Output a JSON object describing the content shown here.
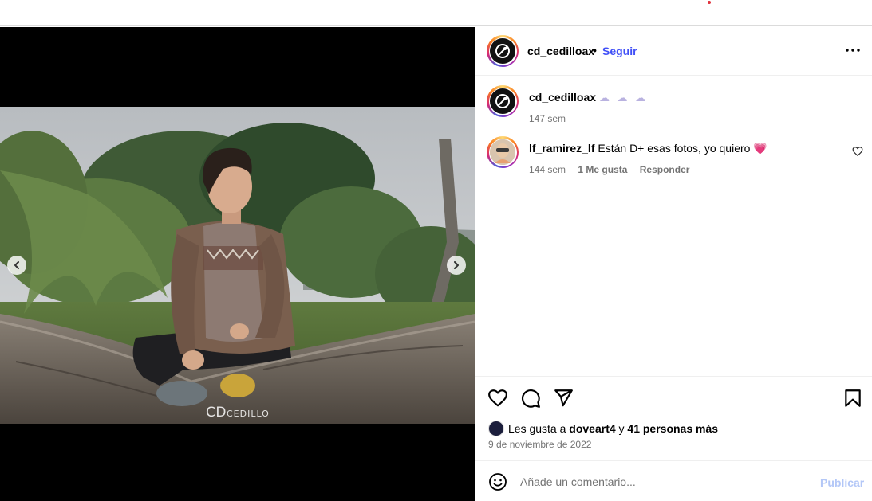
{
  "post": {
    "author": "cd_cedilloax",
    "follow_label": "Seguir",
    "separator": "•",
    "caption_emoji": "☁︎ ☁︎ ☁︎",
    "caption_age": "147 sem",
    "watermark_main": "CD",
    "watermark_sub": "CEDILLO"
  },
  "comments": [
    {
      "username": "lf_ramirez_lf",
      "text": "Están D+ esas fotos, yo quiero",
      "emoji": "💗",
      "age": "144 sem",
      "likes": "1 Me gusta",
      "reply_label": "Responder"
    }
  ],
  "likes": {
    "prefix": "Les gusta a",
    "user": "doveart4",
    "conj": "y",
    "others": "41 personas más"
  },
  "date": "9 de noviembre de 2022",
  "add_comment": {
    "placeholder": "Añade un comentario...",
    "post_label": "Publicar"
  },
  "icons": {
    "more": "more-options-icon",
    "like": "heart-icon",
    "comment": "comment-icon",
    "share": "share-icon",
    "save": "bookmark-icon",
    "emoji": "emoji-icon",
    "prev": "chevron-left-icon",
    "next": "chevron-right-icon"
  },
  "colors": {
    "link_blue": "#4150f7",
    "post_button_disabled": "#b3c7f7",
    "meta_gray": "#737373"
  }
}
